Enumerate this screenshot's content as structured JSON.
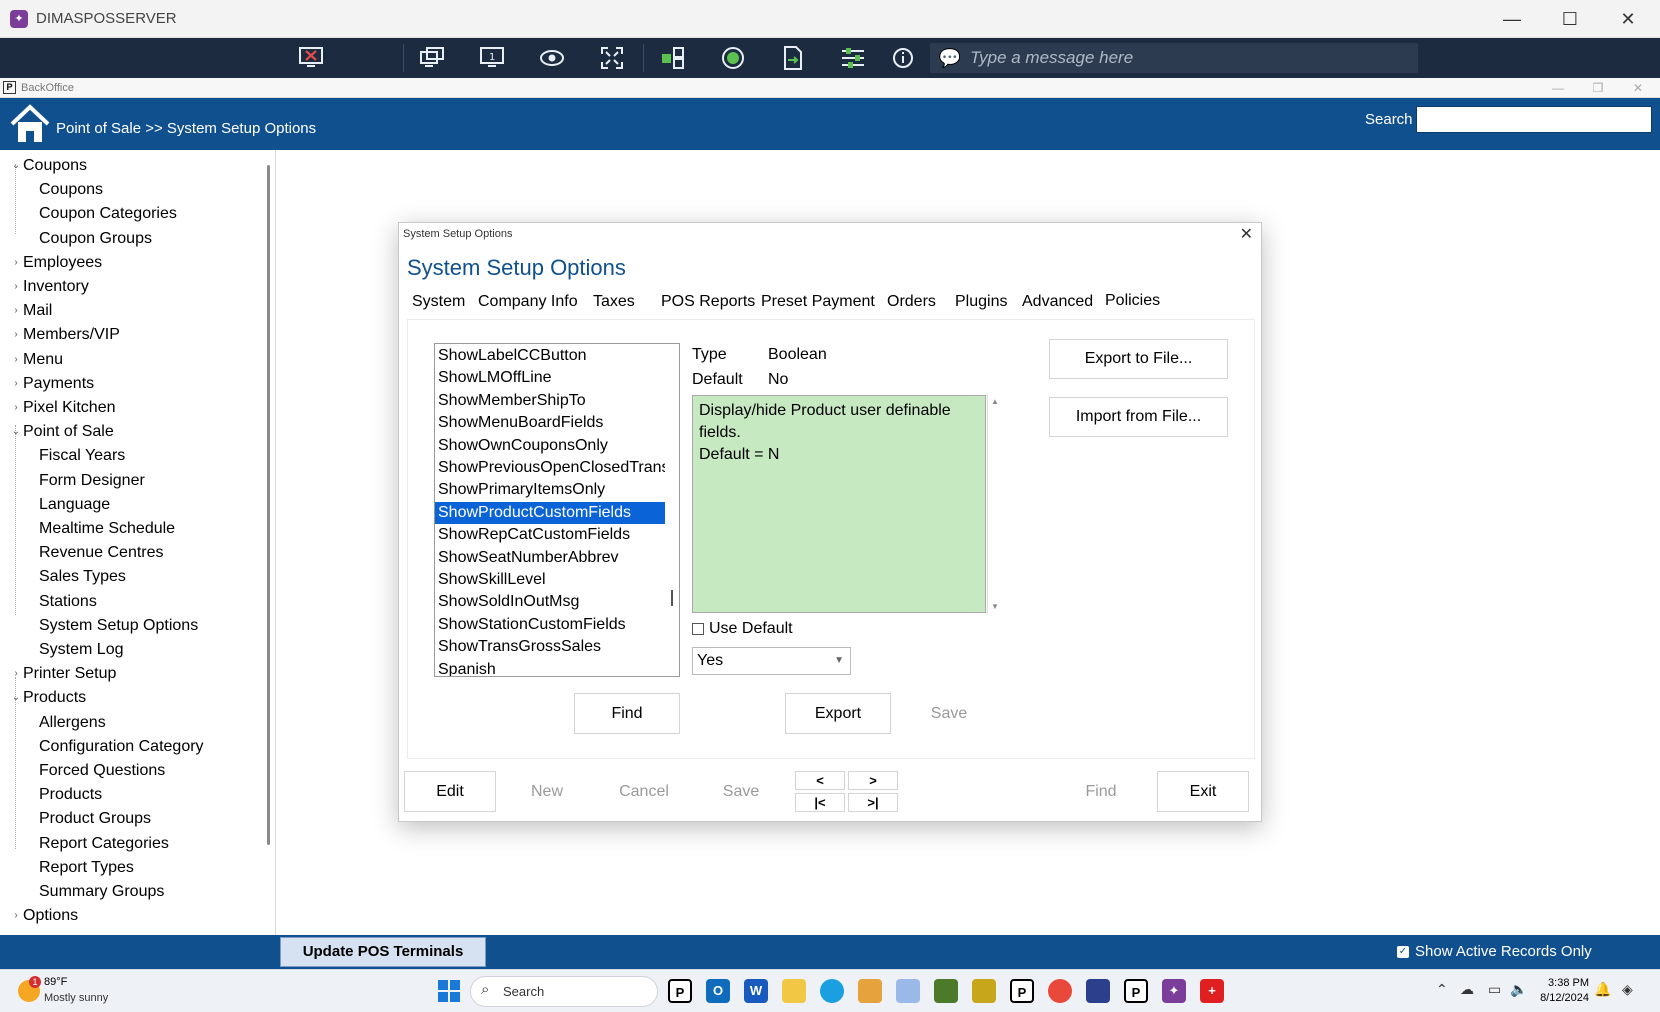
{
  "window": {
    "title": "DIMASPOSSERVER"
  },
  "remote_toolbar": {
    "message_placeholder": "Type a message here",
    "icons": [
      "disconnect-icon",
      "monitor-switch-icon",
      "single-monitor-icon",
      "view-icon",
      "fullscreen-icon",
      "apps-icon",
      "record-icon",
      "file-transfer-icon",
      "settings-sliders-icon",
      "info-icon",
      "chat-icon"
    ]
  },
  "backoffice": {
    "title": "BackOffice"
  },
  "header": {
    "breadcrumb": "Point of Sale >> System Setup Options",
    "search_label": "Search",
    "search_value": ""
  },
  "sidebar": {
    "items": [
      {
        "label": "Coupons",
        "level": 0,
        "expanded": true
      },
      {
        "label": "Coupons",
        "level": 1
      },
      {
        "label": "Coupon Categories",
        "level": 1
      },
      {
        "label": "Coupon Groups",
        "level": 1
      },
      {
        "label": "Employees",
        "level": 0,
        "expanded": false
      },
      {
        "label": "Inventory",
        "level": 0,
        "expanded": false
      },
      {
        "label": "Mail",
        "level": 0,
        "expanded": false
      },
      {
        "label": "Members/VIP",
        "level": 0,
        "expanded": false
      },
      {
        "label": "Menu",
        "level": 0,
        "expanded": false
      },
      {
        "label": "Payments",
        "level": 0,
        "expanded": false
      },
      {
        "label": "Pixel Kitchen",
        "level": 0,
        "expanded": false
      },
      {
        "label": "Point of Sale",
        "level": 0,
        "expanded": true
      },
      {
        "label": "Fiscal Years",
        "level": 1
      },
      {
        "label": "Form Designer",
        "level": 1
      },
      {
        "label": "Language",
        "level": 1
      },
      {
        "label": "Mealtime Schedule",
        "level": 1
      },
      {
        "label": "Revenue Centres",
        "level": 1
      },
      {
        "label": "Sales Types",
        "level": 1
      },
      {
        "label": "Stations",
        "level": 1
      },
      {
        "label": "System Setup Options",
        "level": 1
      },
      {
        "label": "System Log",
        "level": 1
      },
      {
        "label": "Printer Setup",
        "level": 0,
        "expanded": false
      },
      {
        "label": "Products",
        "level": 0,
        "expanded": true
      },
      {
        "label": "Allergens",
        "level": 1
      },
      {
        "label": "Configuration Category",
        "level": 1
      },
      {
        "label": "Forced Questions",
        "level": 1
      },
      {
        "label": "Products",
        "level": 1
      },
      {
        "label": "Product Groups",
        "level": 1
      },
      {
        "label": "Report Categories",
        "level": 1
      },
      {
        "label": "Report Types",
        "level": 1
      },
      {
        "label": "Summary Groups",
        "level": 1
      },
      {
        "label": "Options",
        "level": 0,
        "expanded": false
      }
    ]
  },
  "dialog": {
    "caption": "System Setup Options",
    "title": "System Setup Options",
    "tabs": [
      "System",
      "Company Info",
      "Taxes",
      "POS Reports",
      "Preset Payment",
      "Orders",
      "Plugins",
      "Advanced",
      "Policies"
    ],
    "active_tab": "Policies",
    "options_list": [
      "ShowLabelCCButton",
      "ShowLMOffLine",
      "ShowMemberShipTo",
      "ShowMenuBoardFields",
      "ShowOwnCouponsOnly",
      "ShowPreviousOpenClosedTrans",
      "ShowPrimaryItemsOnly",
      "ShowProductCustomFields",
      "ShowRepCatCustomFields",
      "ShowSeatNumberAbbrev",
      "ShowSkillLevel",
      "ShowSoldInOutMsg",
      "ShowStationCustomFields",
      "ShowTransGrossSales",
      "Spanish"
    ],
    "selected_option": "ShowProductCustomFields",
    "type_label": "Type",
    "type_value": "Boolean",
    "default_label": "Default",
    "default_value": "No",
    "description": "Display/hide Product user definable\nfields.\nDefault = N",
    "description_bg": "#c7e9c1",
    "use_default_label": "Use Default",
    "use_default_checked": false,
    "value_select": "Yes",
    "buttons": {
      "export_to_file": "Export to File...",
      "import_from_file": "Import from File...",
      "find": "Find",
      "export": "Export",
      "save": "Save"
    },
    "footer": {
      "edit": "Edit",
      "new": "New",
      "cancel": "Cancel",
      "save": "Save",
      "prev": "<",
      "next": ">",
      "first": "|<",
      "last": ">|",
      "find": "Find",
      "exit": "Exit"
    }
  },
  "statusbar": {
    "update_button": "Update POS Terminals",
    "show_active_label": "Show Active Records Only",
    "show_active_checked": true
  },
  "taskbar": {
    "weather_temp": "89°F",
    "weather_cond": "Mostly sunny",
    "weather_badge": "1",
    "search_label": "Search",
    "time": "3:38 PM",
    "date": "8/12/2024"
  },
  "colors": {
    "header_blue": "#11508f",
    "selection_blue": "#0a64d8",
    "remote_bar": "#1c2b3f"
  }
}
